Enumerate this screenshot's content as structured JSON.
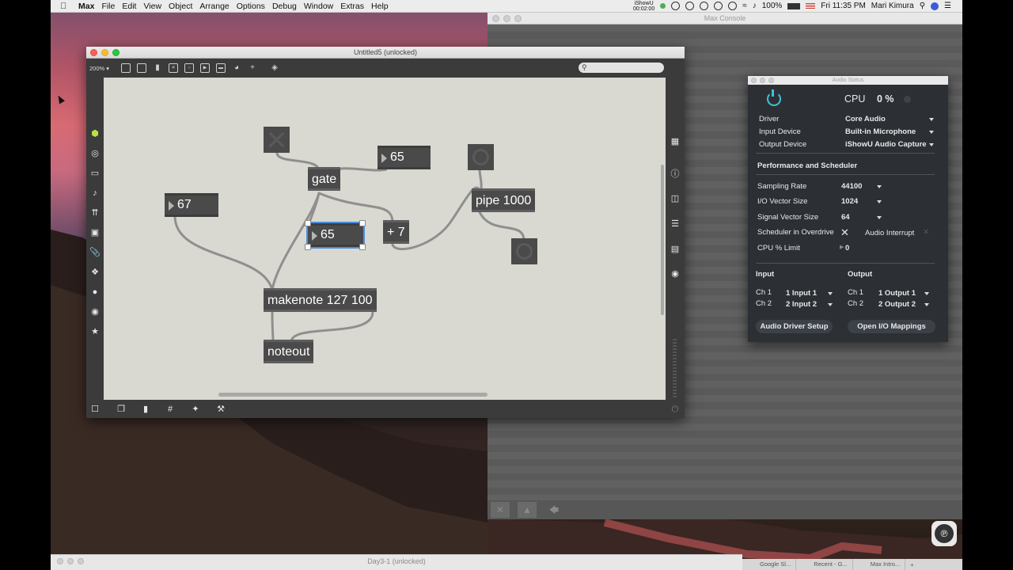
{
  "menubar": {
    "app": "Max",
    "items": [
      "File",
      "Edit",
      "View",
      "Object",
      "Arrange",
      "Options",
      "Debug",
      "Window",
      "Extras",
      "Help"
    ],
    "recorder_line1": "iShowU",
    "recorder_line2": "00:02:00",
    "battery": "100%",
    "clock": "Fri 11:35 PM",
    "user": "Mari Kimura"
  },
  "console": {
    "title": "Max Console"
  },
  "patcher": {
    "title": "Untitled5 (unlocked)",
    "zoom": "200%",
    "objects": {
      "gate": "gate",
      "plus7": "+ 7",
      "pipe": "pipe 1000",
      "makenote": "makenote 127 100",
      "noteout": "noteout"
    },
    "numbers": {
      "n67": "67",
      "n65_top": "65",
      "n65_sel": "65"
    }
  },
  "audio_status": {
    "title": "Audio Status",
    "cpu_label": "CPU",
    "cpu_value": "0 %",
    "driver_label": "Driver",
    "driver_value": "Core Audio",
    "input_device_label": "Input Device",
    "input_device_value": "Built-in Microphone",
    "output_device_label": "Output Device",
    "output_device_value": "iShowU Audio Capture",
    "perf_header": "Performance and Scheduler",
    "sampling_rate_label": "Sampling Rate",
    "sampling_rate_value": "44100",
    "io_vector_label": "I/O Vector Size",
    "io_vector_value": "1024",
    "signal_vector_label": "Signal Vector Size",
    "signal_vector_value": "64",
    "overdrive_label": "Scheduler in Overdrive",
    "interrupt_label": "Audio Interrupt",
    "cpu_limit_label": "CPU % Limit",
    "cpu_limit_value": "0",
    "input_header": "Input",
    "output_header": "Output",
    "in_ch1_label": "Ch 1",
    "in_ch1_value": "1 Input 1",
    "in_ch2_label": "Ch 2",
    "in_ch2_value": "2 Input 2",
    "out_ch1_label": "Ch 1",
    "out_ch1_value": "1 Output 1",
    "out_ch2_label": "Ch 2",
    "out_ch2_value": "2 Output 2",
    "driver_setup_button": "Audio Driver Setup",
    "io_mappings_button": "Open I/O Mappings",
    "accent_color": "#40c0d8"
  },
  "bottom_window": {
    "title": "Day3-1 (unlocked)"
  },
  "chrome_tabs": [
    "Google Sl...",
    "Recent - G...",
    "Max Intro..."
  ]
}
